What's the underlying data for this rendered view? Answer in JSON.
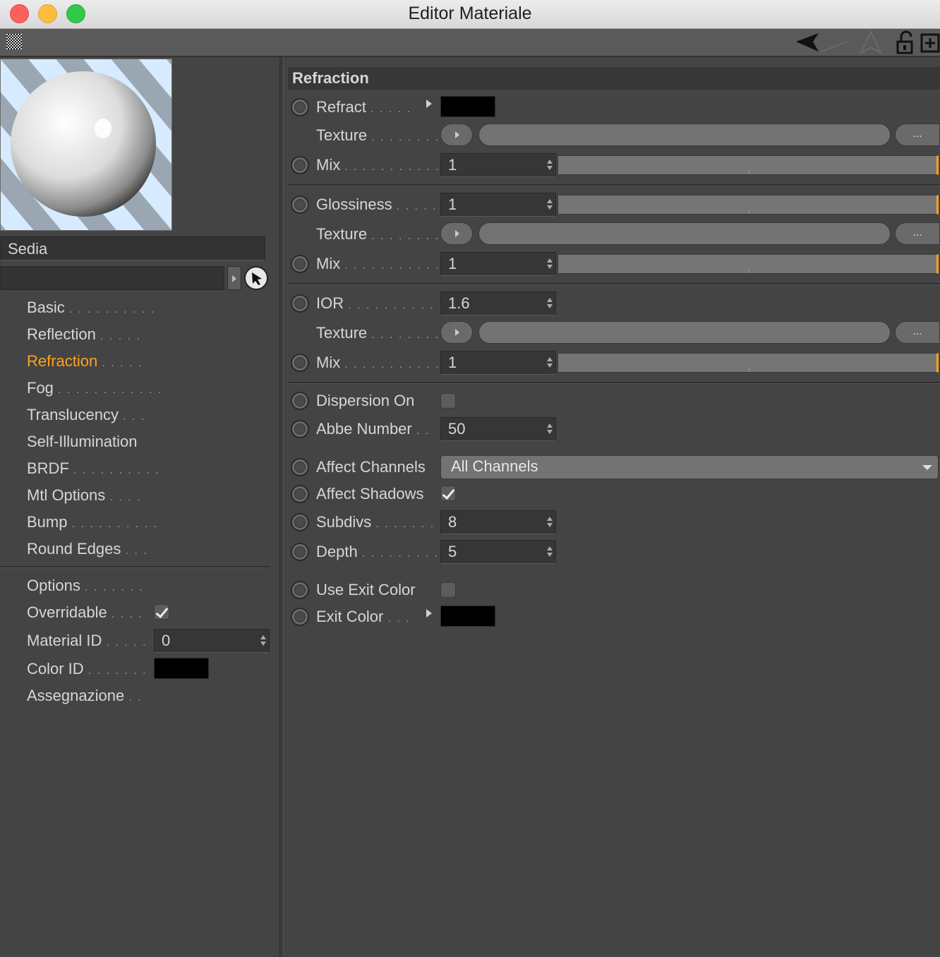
{
  "window": {
    "title": "Editor Materiale"
  },
  "material": {
    "name": "Sedia",
    "subfield": ""
  },
  "nav": {
    "channels": [
      {
        "label": "Basic",
        "dots": ". . . . . . . . . ."
      },
      {
        "label": "Reflection",
        "dots": ". . . . ."
      },
      {
        "label": "Refraction",
        "dots": ". . . . .",
        "active": true
      },
      {
        "label": "Fog",
        "dots": ". . . . . . . . . . . ."
      },
      {
        "label": "Translucency",
        "dots": ". . ."
      },
      {
        "label": "Self-Illumination",
        "dots": ""
      },
      {
        "label": "BRDF",
        "dots": ". . . . . . . . . ."
      },
      {
        "label": "Mtl Options",
        "dots": ". . . ."
      },
      {
        "label": "Bump",
        "dots": ". . . . . . . . . ."
      },
      {
        "label": "Round Edges",
        "dots": ". . ."
      }
    ],
    "options": {
      "options_label": "Options",
      "options_dots": ". . . . . . .",
      "overridable_label": "Overridable",
      "overridable_dots": ". . . .",
      "overridable_checked": true,
      "material_id_label": "Material ID",
      "material_id_dots": ". . . . .",
      "material_id_value": "0",
      "color_id_label": "Color ID",
      "color_id_dots": ". . . . . . .",
      "color_id_color": "#000000",
      "assign_label": "Assegnazione",
      "assign_dots": ". ."
    }
  },
  "refraction": {
    "section_title": "Refraction",
    "refract": {
      "label": "Refract",
      "dots": ". . . . .",
      "color": "#000000"
    },
    "texture_label": "Texture",
    "texture_dots": ". . . . . . . .",
    "mix_label": "Mix",
    "mix_dots": ". . . . . . . . . . .",
    "more_label": "...",
    "mix1_value": "1",
    "glossiness": {
      "label": "Glossiness",
      "dots": ". . . . .",
      "value": "1"
    },
    "mix2_value": "1",
    "ior": {
      "label": "IOR",
      "dots": ". . . . . . . . . . .",
      "value": "1.6"
    },
    "mix3_value": "1",
    "dispersion_on": {
      "label": "Dispersion On",
      "checked": false
    },
    "abbe": {
      "label": "Abbe Number",
      "dots": ". .",
      "value": "50"
    },
    "affect_channels": {
      "label": "Affect Channels",
      "value": "All Channels"
    },
    "affect_shadows": {
      "label": "Affect Shadows",
      "checked": true
    },
    "subdivs": {
      "label": "Subdivs",
      "dots": ". . . . . . .",
      "value": "8"
    },
    "depth": {
      "label": "Depth",
      "dots": ". . . . . . . . .",
      "value": "5"
    },
    "use_exit_color": {
      "label": "Use Exit Color",
      "checked": false
    },
    "exit_color": {
      "label": "Exit Color",
      "dots": ". . .",
      "color": "#000000"
    }
  },
  "colors": {
    "accent": "#ffa21e",
    "panel": "#444444",
    "field": "#363636"
  }
}
